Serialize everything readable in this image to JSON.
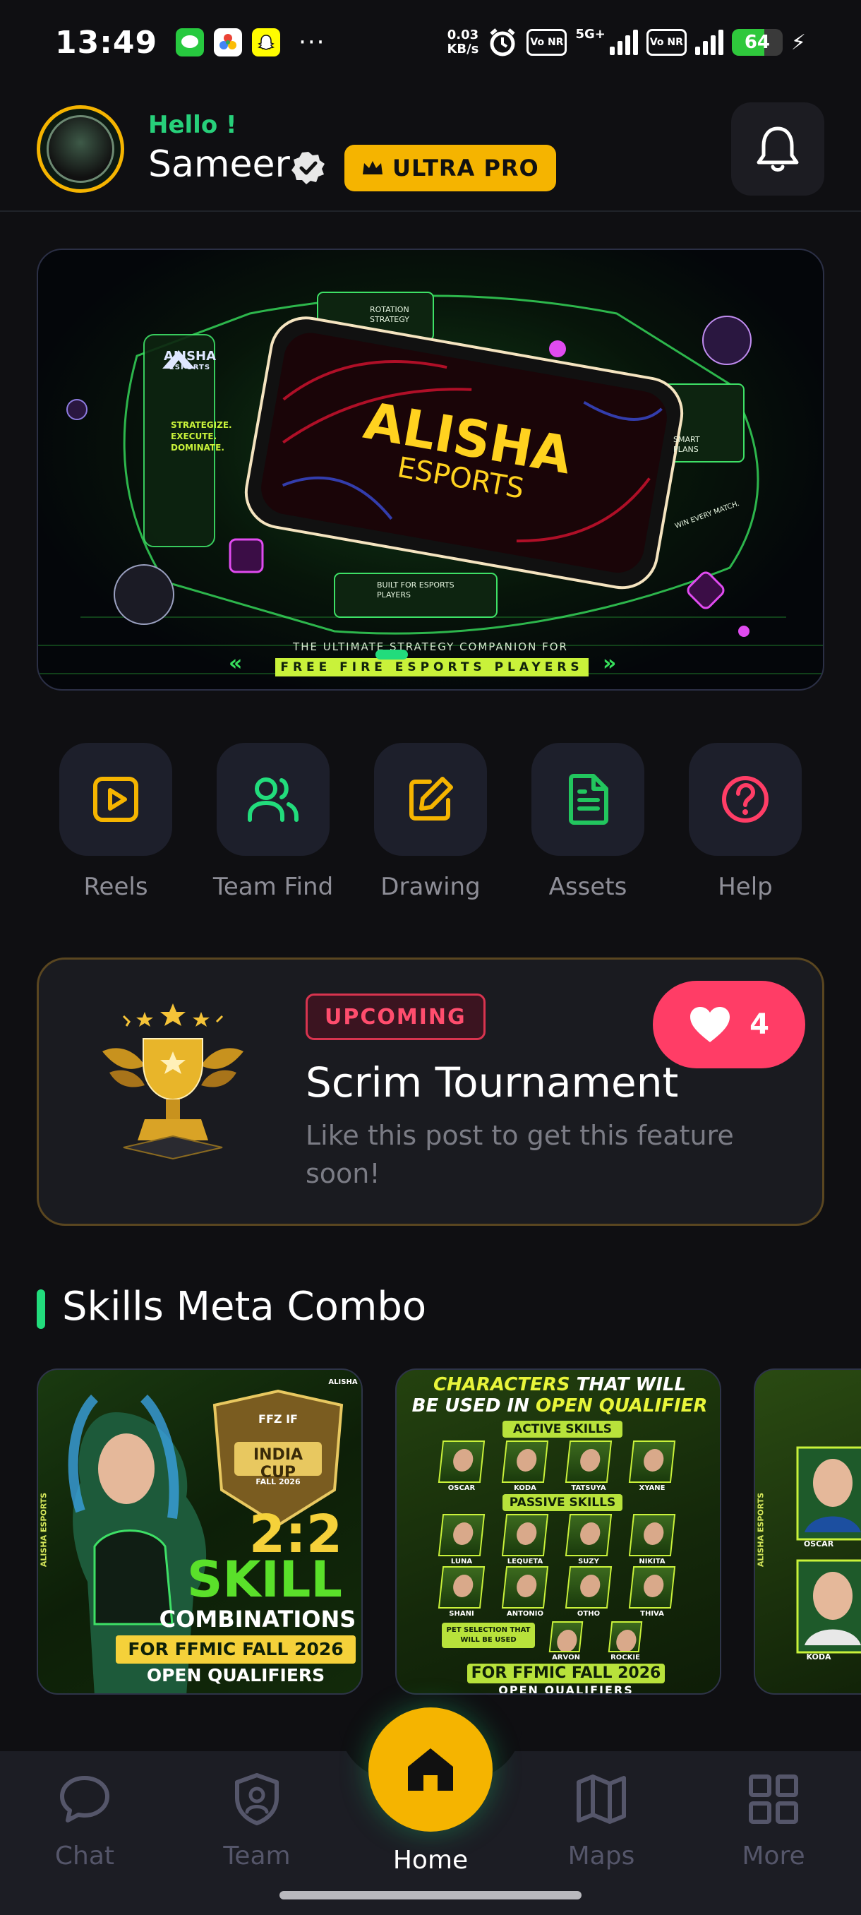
{
  "status_bar": {
    "time": "13:49",
    "net_speed_value": "0.03",
    "net_speed_unit": "KB/s",
    "vo_nr_1": "Vo NR",
    "network_type": "5G+",
    "vo_nr_2": "Vo NR",
    "battery": "64",
    "battery_level_pct": 64,
    "notification_icons": [
      "messages-icon",
      "photos-icon",
      "snapchat-icon"
    ]
  },
  "header": {
    "greeting": "Hello !",
    "username": "Sameer",
    "badge": "ULTRA PRO"
  },
  "banner": {
    "title_line1": "ALISHA",
    "title_line2": "ESPORTS",
    "logo_line1": "ALISHA",
    "logo_line2": "ESPORTS",
    "tagline": [
      "STRATEGIZE.",
      "EXECUTE.",
      "DOMINATE."
    ],
    "rotation_label": "ROTATION STRATEGY",
    "smart_plans": "SMART PLANS",
    "win_every_match": "WIN EVERY MATCH.",
    "built_for": "BUILT FOR ESPORTS PLAYERS",
    "subtitle": "THE ULTIMATE STRATEGY COMPANION FOR",
    "strip": "FREE FIRE ESPORTS PLAYERS",
    "arrows_left": "«",
    "arrows_right": "»"
  },
  "quick_actions": [
    {
      "label": "Reels",
      "icon": "play-icon",
      "color": "#f5b400"
    },
    {
      "label": "Team Find",
      "icon": "users-icon",
      "color": "#22dc7c"
    },
    {
      "label": "Drawing",
      "icon": "edit-icon",
      "color": "#f5b400"
    },
    {
      "label": "Assets",
      "icon": "document-icon",
      "color": "#22c55e"
    },
    {
      "label": "Help",
      "icon": "help-icon",
      "color": "#ff3d66"
    }
  ],
  "tournament": {
    "tag": "UPCOMING",
    "title": "Scrim Tournament",
    "description": "Like this post to get this feature soon!",
    "likes": "4"
  },
  "skills": {
    "section_title": "Skills Meta Combo",
    "card1": {
      "cup_top": "FFZ IF",
      "cup_name": "INDIA CUP",
      "cup_season": "FALL 2026",
      "ratio": "2:2",
      "word": "SKILL",
      "word2": "COMBINATIONS",
      "line": "FOR FFMIC FALL 2026",
      "line2": "OPEN QUALIFIERS",
      "side_text": "ALISHA ESPORTS",
      "corner_logo": "ALISHA"
    },
    "card2": {
      "headline_a": "CHARACTERS",
      "headline_b": "THAT WILL",
      "headline_c": "BE USED IN",
      "headline_d": "OPEN QUALIFIER",
      "active_label": "ACTIVE SKILLS",
      "active_names": [
        "OSCAR",
        "KODA",
        "TATSUYA",
        "XYANE"
      ],
      "passive_label": "PASSIVE SKILLS",
      "passive_row1": [
        "LUNA",
        "LEQUETA",
        "SUZY",
        "NIKITA"
      ],
      "passive_row2": [
        "SHANI",
        "ANTONIO",
        "OTHO",
        "THIVA"
      ],
      "pet_label": "PET SELECTION THAT WILL BE USED",
      "pets": [
        "ARVON",
        "ROCKIE"
      ],
      "footer": "FOR FFMIC FALL 2026",
      "footer2": "OPEN QUALIFIERS"
    },
    "card3": {
      "names": [
        "OSCAR",
        "KODA"
      ],
      "side_text": "ALISHA ESPORTS"
    }
  },
  "bottom_nav": {
    "items": [
      {
        "label": "Chat",
        "icon": "chat-icon"
      },
      {
        "label": "Team",
        "icon": "shield-user-icon"
      },
      {
        "label": "Home",
        "icon": "home-icon"
      },
      {
        "label": "Maps",
        "icon": "map-icon"
      },
      {
        "label": "More",
        "icon": "grid-icon"
      }
    ],
    "active": "Home"
  }
}
